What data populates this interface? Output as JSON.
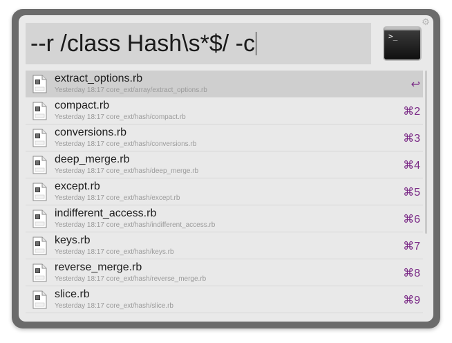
{
  "search": {
    "query": "--r /class Hash\\s*$/ -c"
  },
  "action": {
    "icon": "terminal-icon",
    "prompt": ">_"
  },
  "settings": {
    "icon": "gear-icon"
  },
  "results": [
    {
      "title": "extract_options.rb",
      "subtitle": "Yesterday 18:17 core_ext/array/extract_options.rb",
      "shortcut": "↩",
      "icon": "ruby-file-icon",
      "selected": true
    },
    {
      "title": "compact.rb",
      "subtitle": "Yesterday 18:17 core_ext/hash/compact.rb",
      "shortcut": "⌘2",
      "icon": "ruby-file-icon",
      "selected": false
    },
    {
      "title": "conversions.rb",
      "subtitle": "Yesterday 18:17 core_ext/hash/conversions.rb",
      "shortcut": "⌘3",
      "icon": "ruby-file-icon",
      "selected": false
    },
    {
      "title": "deep_merge.rb",
      "subtitle": "Yesterday 18:17 core_ext/hash/deep_merge.rb",
      "shortcut": "⌘4",
      "icon": "ruby-file-icon",
      "selected": false
    },
    {
      "title": "except.rb",
      "subtitle": "Yesterday 18:17 core_ext/hash/except.rb",
      "shortcut": "⌘5",
      "icon": "ruby-file-icon",
      "selected": false
    },
    {
      "title": "indifferent_access.rb",
      "subtitle": "Yesterday 18:17 core_ext/hash/indifferent_access.rb",
      "shortcut": "⌘6",
      "icon": "ruby-file-icon",
      "selected": false
    },
    {
      "title": "keys.rb",
      "subtitle": "Yesterday 18:17 core_ext/hash/keys.rb",
      "shortcut": "⌘7",
      "icon": "ruby-file-icon",
      "selected": false
    },
    {
      "title": "reverse_merge.rb",
      "subtitle": "Yesterday 18:17 core_ext/hash/reverse_merge.rb",
      "shortcut": "⌘8",
      "icon": "ruby-file-icon",
      "selected": false
    },
    {
      "title": "slice.rb",
      "subtitle": "Yesterday 18:17 core_ext/hash/slice.rb",
      "shortcut": "⌘9",
      "icon": "ruby-file-icon",
      "selected": false
    }
  ],
  "colors": {
    "accent": "#7a2a86",
    "selected_row": "#cfcfcf",
    "panel": "#e9e9e9"
  }
}
